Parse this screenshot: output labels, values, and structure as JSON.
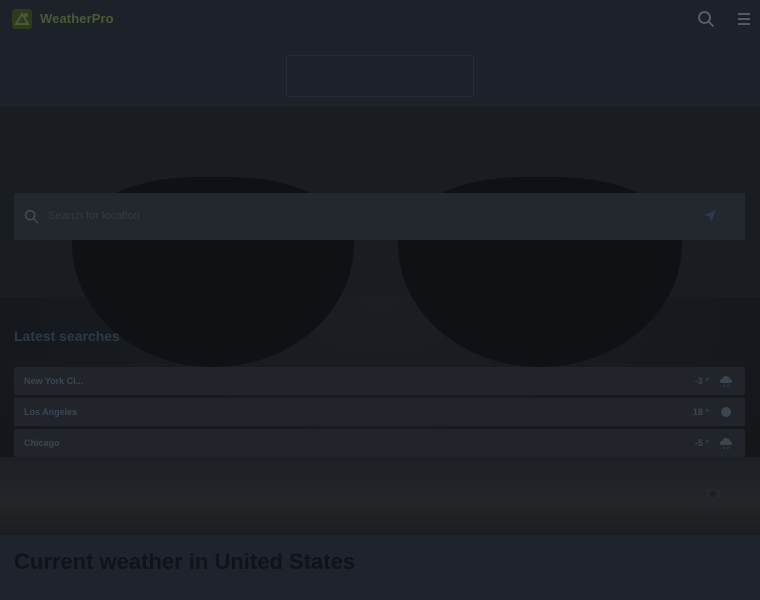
{
  "header": {
    "brand": "WeatherPro",
    "icons": {
      "logo": "weatherpro-logo-icon",
      "search": "search-icon",
      "menu": "hamburger-menu-icon"
    }
  },
  "search": {
    "placeholder": "Search for location",
    "icons": {
      "search": "search-icon",
      "locate": "location-arrow-icon"
    }
  },
  "latest": {
    "title": "Latest searches",
    "items": [
      {
        "city": "New York Ci...",
        "temp": "-3 °",
        "icon": "snow-cloud-icon"
      },
      {
        "city": "Los Angeles",
        "temp": "18 °",
        "icon": "sun-icon"
      },
      {
        "city": "Chicago",
        "temp": "-5 °",
        "icon": "snow-cloud-icon"
      }
    ]
  },
  "main": {
    "title": "Current weather in United States"
  },
  "colors": {
    "background": "#1f242c",
    "brand": "#4a5a32",
    "accent": "#2b3a48"
  }
}
